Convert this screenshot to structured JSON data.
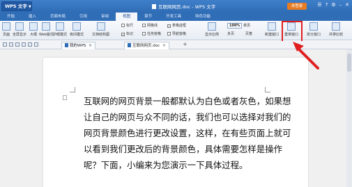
{
  "titlebar": {
    "app_label": "WPS 文字",
    "doc_title": "互联网网页.doc - WPS 文字",
    "login_label": "未登录",
    "icons": [
      "skin-icon",
      "help-icon",
      "settings-icon",
      "minimize-icon",
      "close-icon"
    ]
  },
  "menu": {
    "tabs": [
      "开始",
      "插入",
      "页面布局",
      "引用",
      "审阅",
      "视图",
      "章节",
      "开发工具",
      "特色功能"
    ],
    "active_index": 5
  },
  "ribbon": {
    "view_group": [
      "页面",
      "全屏显示",
      "大纲",
      "Web版式",
      "护眼模式",
      "夜间模式"
    ],
    "doc_structure": "文档结构图",
    "checks_row1": [
      "标尺",
      "网格线",
      "表格虚框"
    ],
    "checks_row2": [
      "标记",
      "任务窗格",
      "导航窗格"
    ],
    "show_scale": "显示比例",
    "zoom_value": "100%",
    "single_page": "单页",
    "multi_page": "多页",
    "page_width": "页宽",
    "new_window": "新建窗口",
    "rearrange": "重排窗口",
    "split_window": "拆分窗口",
    "side_by_side": "并排比较"
  },
  "doctabs": {
    "tab1": "我的WPS",
    "tab2": "互联网网页.doc",
    "new_tab": "+"
  },
  "document": {
    "paragraph": "互联网的网页背景一般都默认为白色或者灰色，如果想让自己的网页与众不同的话，我们也可以选择对我们的网页背景颜色进行更改设置，这样，在有些页面上就可以看到我们更改后的背景颜色，具体需要怎样是操作呢？下面，小编来为您演示一下具体过程。"
  },
  "colors": {
    "titlebar_blue": "#2f6db6",
    "annotation_red": "#e02020",
    "login_orange": "#e87c22"
  }
}
